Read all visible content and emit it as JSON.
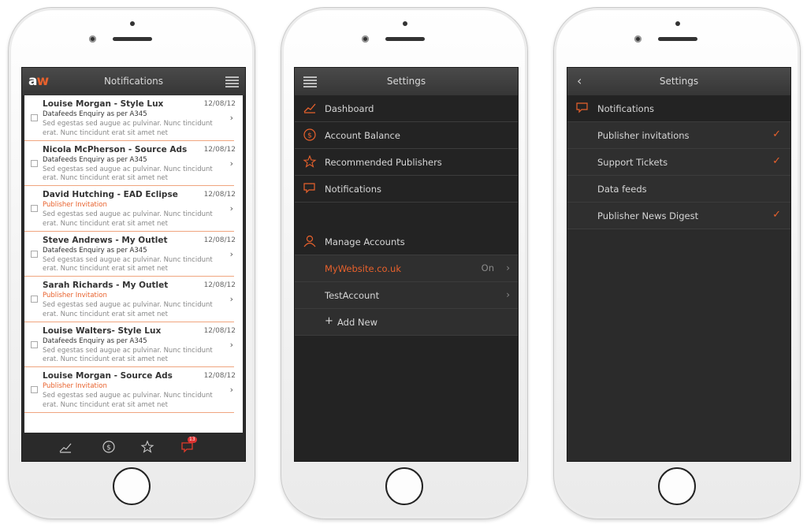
{
  "screens": {
    "notifications": {
      "logo_a": "a",
      "logo_w": "w",
      "title": "Notifications",
      "items": [
        {
          "name": "Louise Morgan - Style Lux",
          "date": "12/08/12",
          "subject": "Datafeeds Enquiry as per A345",
          "invite": false,
          "body": "Sed egestas sed augue ac pulvinar. Nunc tincidunt erat. Nunc tincidunt erat sit amet net"
        },
        {
          "name": "Nicola McPherson - Source Ads",
          "date": "12/08/12",
          "subject": "Datafeeds Enquiry as per A345",
          "invite": false,
          "body": "Sed egestas sed augue ac pulvinar. Nunc tincidunt erat. Nunc tincidunt erat sit amet net"
        },
        {
          "name": "David Hutching - EAD Eclipse",
          "date": "12/08/12",
          "subject": "Publisher Invitation",
          "invite": true,
          "body": "Sed egestas sed augue ac pulvinar. Nunc tincidunt erat. Nunc tincidunt erat sit amet net"
        },
        {
          "name": "Steve Andrews - My Outlet",
          "date": "12/08/12",
          "subject": "Datafeeds Enquiry as per A345",
          "invite": false,
          "body": "Sed egestas sed augue ac pulvinar. Nunc tincidunt erat. Nunc tincidunt erat sit amet net"
        },
        {
          "name": "Sarah Richards - My Outlet",
          "date": "12/08/12",
          "subject": "Publisher Invitation",
          "invite": true,
          "body": "Sed egestas sed augue ac pulvinar. Nunc tincidunt erat. Nunc tincidunt erat sit amet net"
        },
        {
          "name": "Louise Walters- Style Lux",
          "date": "12/08/12",
          "subject": "Datafeeds Enquiry as per A345",
          "invite": false,
          "body": "Sed egestas sed augue ac pulvinar. Nunc tincidunt erat. Nunc tincidunt erat sit amet net"
        },
        {
          "name": "Louise Morgan - Source Ads",
          "date": "12/08/12",
          "subject": "Publisher Invitation",
          "invite": true,
          "body": "Sed egestas sed augue ac pulvinar. Nunc tincidunt erat. Nunc tincidunt erat sit amet net"
        }
      ],
      "tabs": [
        "chart-icon",
        "dollar-icon",
        "star-icon",
        "chat-icon"
      ],
      "badge": "13",
      "accent": "#e8612c"
    },
    "settings_menu": {
      "title": "Settings",
      "menu": [
        {
          "label": "Dashboard",
          "icon": "chart-icon"
        },
        {
          "label": "Account Balance",
          "icon": "dollar-icon"
        },
        {
          "label": "Recommended Publishers",
          "icon": "star-icon"
        },
        {
          "label": "Notifications",
          "icon": "chat-icon"
        }
      ],
      "manage_label": "Manage Accounts",
      "accounts": [
        {
          "label": "MyWebsite.co.uk",
          "status": "On",
          "active": true
        },
        {
          "label": "TestAccount",
          "status": "",
          "active": false
        }
      ],
      "add_new": "Add New"
    },
    "settings_notifications": {
      "title": "Settings",
      "section": "Notifications",
      "options": [
        {
          "label": "Publisher invitations",
          "checked": true
        },
        {
          "label": "Support Tickets",
          "checked": true
        },
        {
          "label": "Data feeds",
          "checked": false
        },
        {
          "label": "Publisher News Digest",
          "checked": true
        }
      ]
    }
  }
}
